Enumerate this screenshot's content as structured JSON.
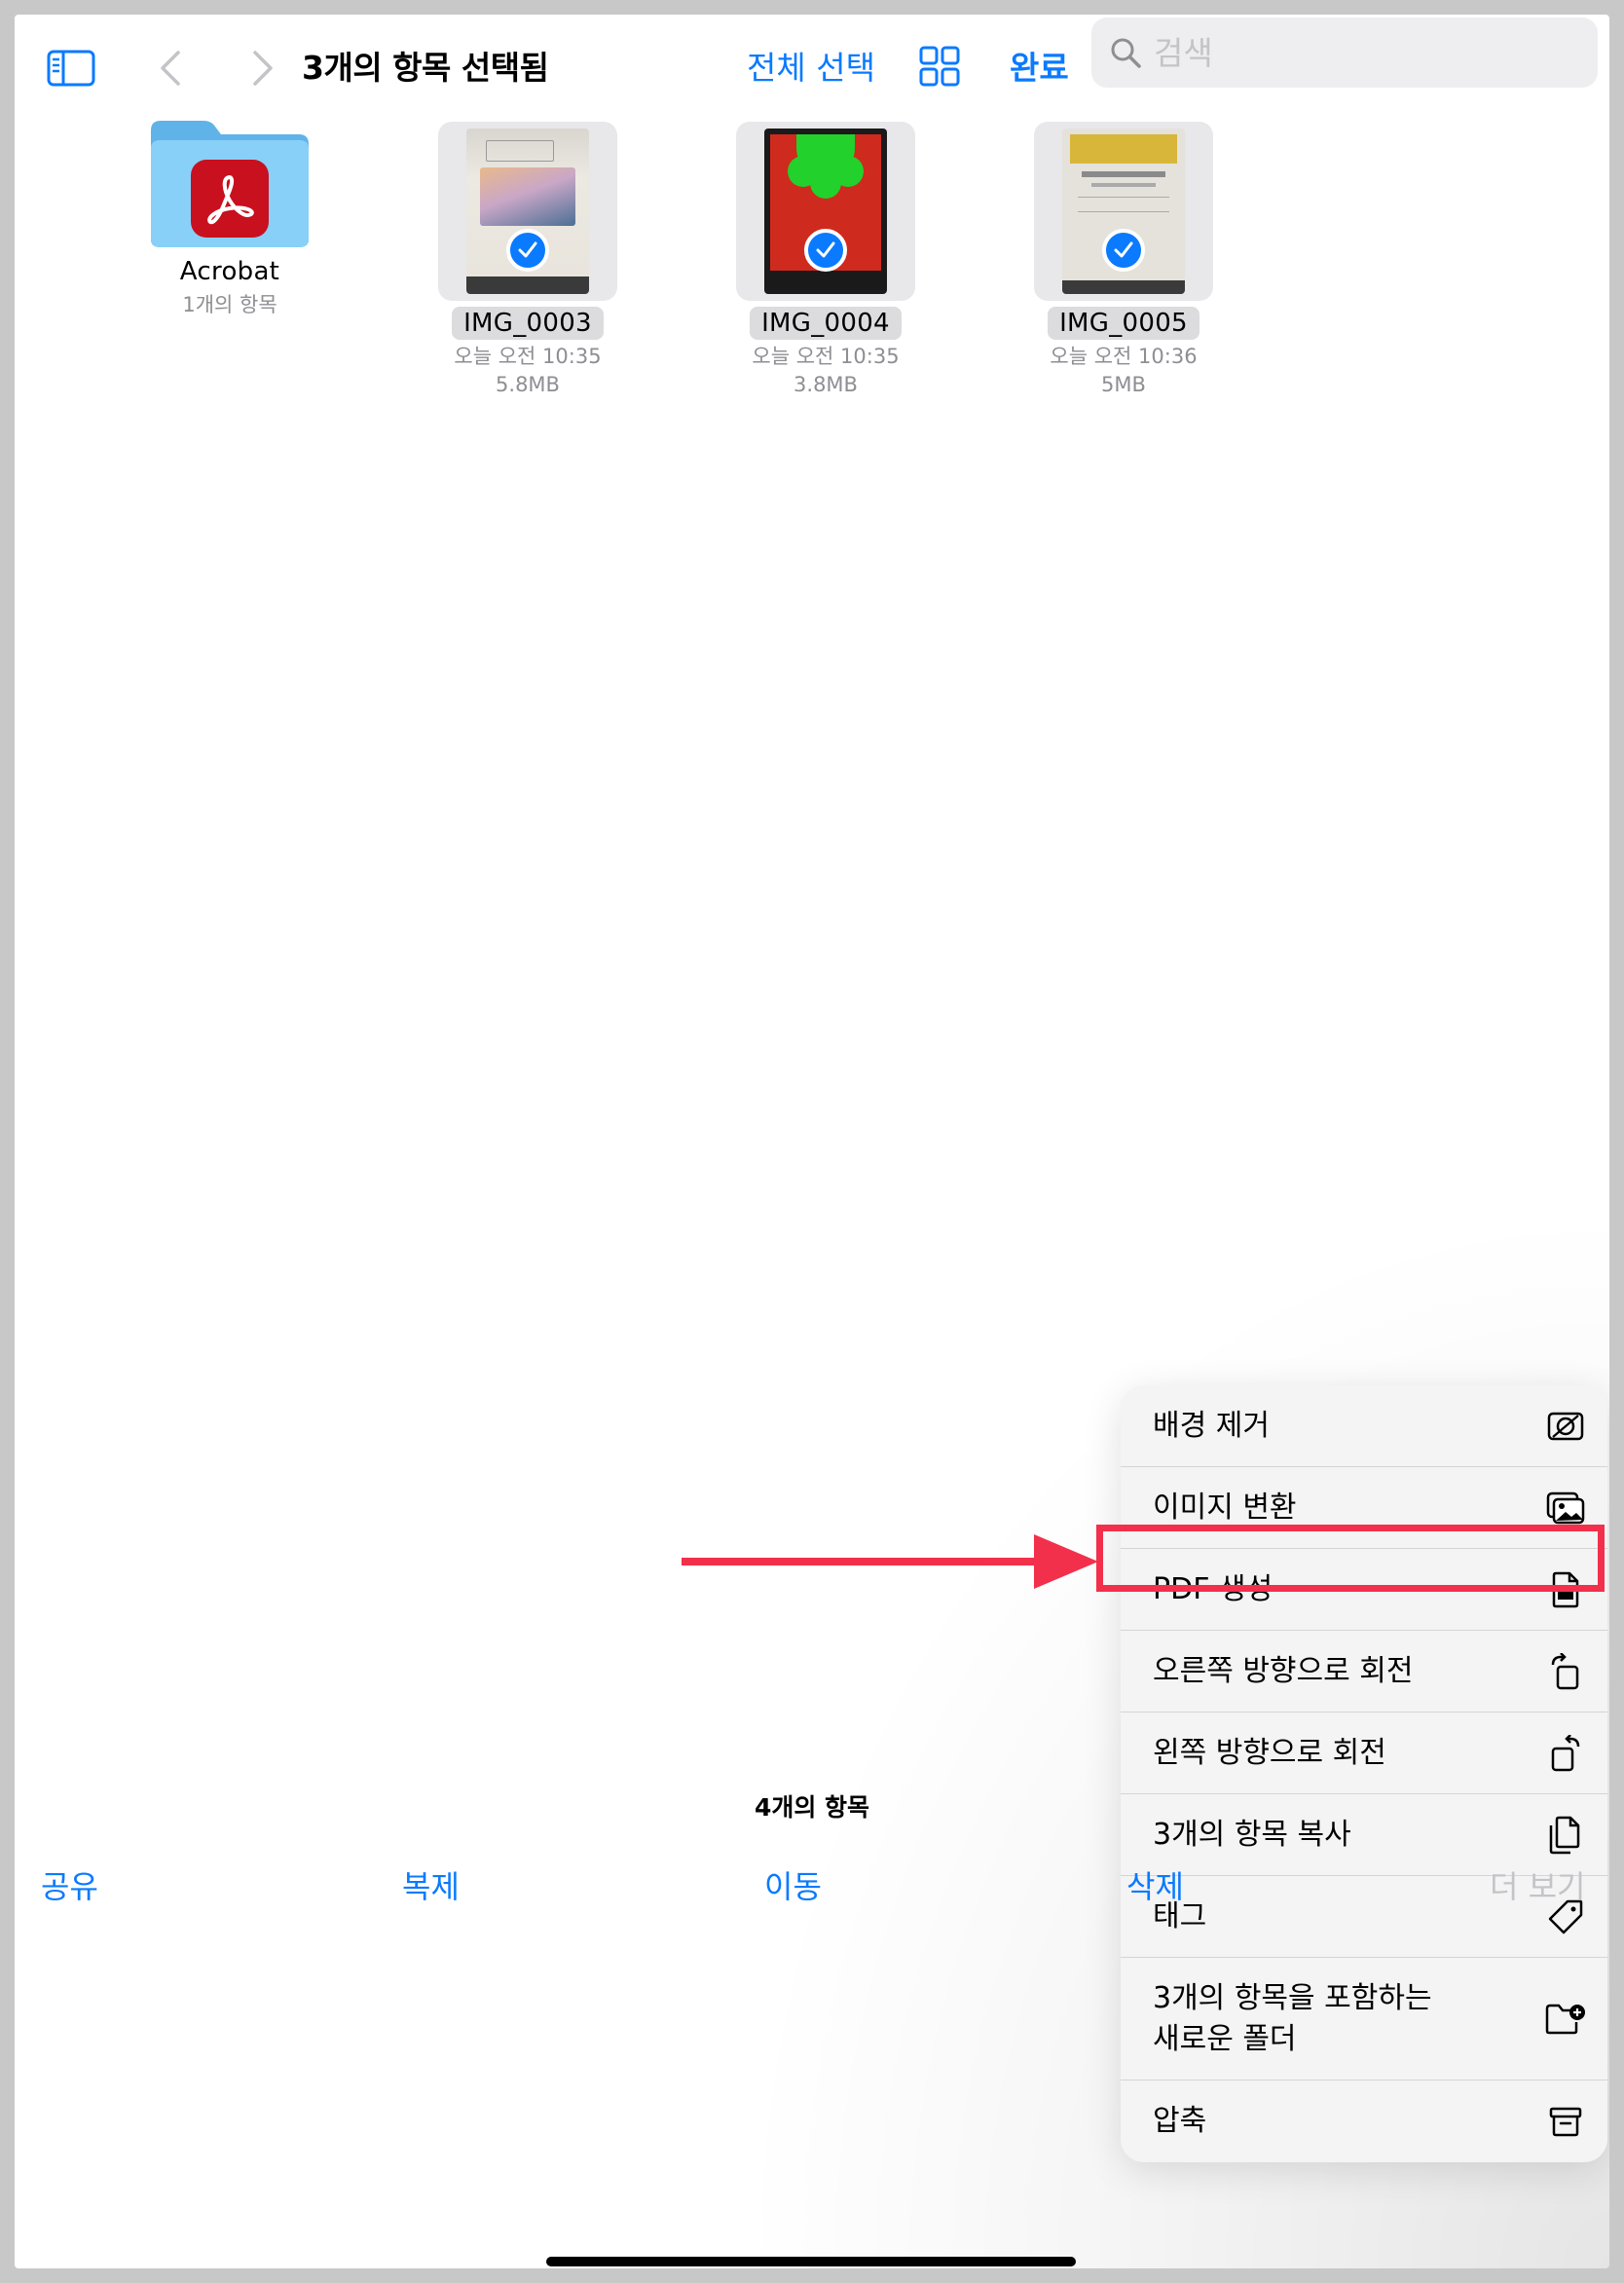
{
  "toolbar": {
    "title": "3개의 항목 선택됨",
    "select_all_label": "전체 선택",
    "done_label": "완료",
    "search_placeholder": "검색"
  },
  "files": [
    {
      "name": "Acrobat",
      "meta1": "1개의 항목",
      "meta2": "",
      "kind": "folder"
    },
    {
      "name": "IMG_0003",
      "meta1": "오늘 오전 10:35",
      "meta2": "5.8MB",
      "kind": "photo"
    },
    {
      "name": "IMG_0004",
      "meta1": "오늘 오전 10:35",
      "meta2": "3.8MB",
      "kind": "photo"
    },
    {
      "name": "IMG_0005",
      "meta1": "오늘 오전 10:36",
      "meta2": "5MB",
      "kind": "photo"
    }
  ],
  "menu": {
    "items": [
      {
        "label": "배경 제거",
        "icon": "remove-background-icon"
      },
      {
        "label": "이미지 변환",
        "icon": "convert-image-icon"
      },
      {
        "label": "PDF 생성",
        "icon": "pdf-document-icon"
      },
      {
        "label": "오른쪽 방향으로 회전",
        "icon": "rotate-right-icon"
      },
      {
        "label": "왼쪽 방향으로 회전",
        "icon": "rotate-left-icon"
      },
      {
        "label": "3개의 항목 복사",
        "icon": "copy-documents-icon"
      },
      {
        "label": "태그",
        "icon": "tag-icon"
      },
      {
        "label_line1": "3개의 항목을 포함하는",
        "label_line2": "새로운 폴더",
        "icon": "new-folder-icon"
      },
      {
        "label": "압축",
        "icon": "archive-box-icon"
      }
    ]
  },
  "footer": {
    "item_count": "4개의 항목"
  },
  "bottom_bar": {
    "share": "공유",
    "duplicate": "복제",
    "move": "이동",
    "delete": "삭제",
    "more": "더 보기"
  },
  "colors": {
    "accent": "#0a7aff",
    "highlight": "#f2304c",
    "folder": "#7dc9f5",
    "acrobat": "#c8101e"
  }
}
